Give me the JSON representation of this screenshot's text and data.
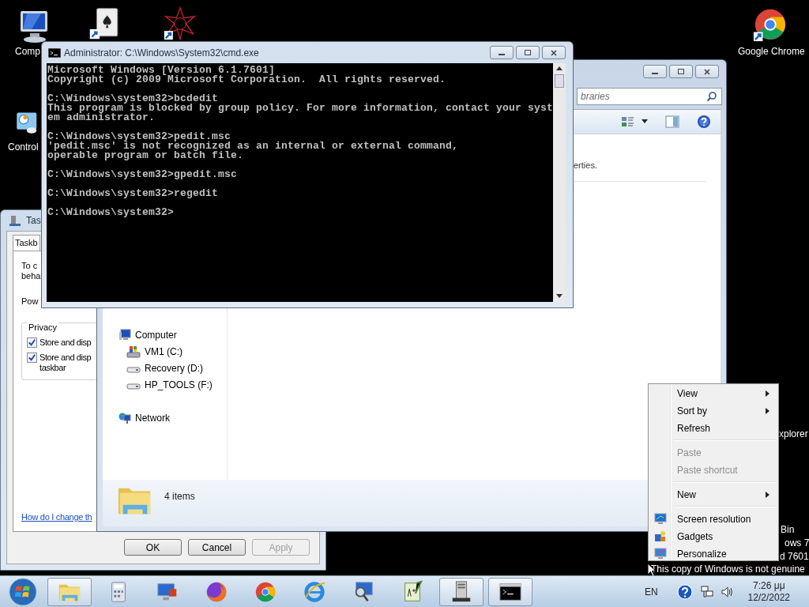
{
  "desktop": {
    "icons": [
      {
        "kind": "computer",
        "label": "Comp"
      },
      {
        "kind": "cards"
      },
      {
        "kind": "star"
      },
      {
        "kind": "control",
        "label": "Control"
      },
      {
        "kind": "chrome",
        "label": "Google Chrome"
      },
      {
        "kind": "ie",
        "label": "xplorer"
      },
      {
        "kind": "bin",
        "label": "Bin"
      }
    ],
    "watermark": [
      "ows 7",
      "d 7601",
      "This copy of Windows is not genuine"
    ]
  },
  "taskbar_dialog": {
    "title": "Tas",
    "tabs": [
      {
        "label": "Taskb",
        "selected": true
      }
    ],
    "texts": [
      "To c",
      "beha",
      "Pow"
    ],
    "group": {
      "title": "Privacy",
      "checkboxes": [
        {
          "lines": [
            "Store and disp"
          ],
          "checked": true
        },
        {
          "lines": [
            "Store and disp",
            "taskbar"
          ],
          "checked": true
        }
      ]
    },
    "link": "How do I change th",
    "buttons": [
      {
        "label": "OK",
        "disabled": false
      },
      {
        "label": "Cancel",
        "disabled": false
      },
      {
        "label": "Apply",
        "disabled": true
      }
    ]
  },
  "explorer": {
    "search": {
      "placeholder": "braries"
    },
    "content_text": "erties.",
    "nav": [
      {
        "label": "Computer",
        "children": [
          {
            "label": "VM1 (C:)"
          },
          {
            "label": "Recovery (D:)"
          },
          {
            "label": "HP_TOOLS (F:)"
          }
        ]
      },
      {
        "label": "Network"
      }
    ],
    "status": "4 items"
  },
  "cmd": {
    "title": "Administrator: C:\\Windows\\System32\\cmd.exe",
    "blocks": [
      [
        "Microsoft Windows [Version 6.1.7601]",
        "Copyright (c) 2009 Microsoft Corporation.  All rights reserved."
      ],
      [
        "C:\\Windows\\system32>bcdedit",
        "This program is blocked by group policy. For more information, contact your syst",
        "em administrator."
      ],
      [
        "C:\\Windows\\system32>pedit.msc",
        "'pedit.msc' is not recognized as an internal or external command,",
        "operable program or batch file."
      ],
      [
        "C:\\Windows\\system32>gpedit.msc"
      ],
      [
        "C:\\Windows\\system32>regedit"
      ],
      [
        "C:\\Windows\\system32>"
      ]
    ]
  },
  "context_menu": {
    "groups": [
      [
        {
          "label": "View",
          "submenu": true,
          "disabled": false
        },
        {
          "label": "Sort by",
          "submenu": true,
          "disabled": false
        },
        {
          "label": "Refresh",
          "submenu": false,
          "disabled": false
        }
      ],
      [
        {
          "label": "Paste",
          "submenu": false,
          "disabled": true
        },
        {
          "label": "Paste shortcut",
          "submenu": false,
          "disabled": true
        }
      ],
      [
        {
          "label": "New",
          "submenu": true,
          "disabled": false
        }
      ],
      [
        {
          "label": "Screen resolution",
          "submenu": false,
          "disabled": false
        },
        {
          "label": "Gadgets",
          "submenu": false,
          "disabled": false
        },
        {
          "label": "Personalize",
          "submenu": false,
          "disabled": false
        }
      ]
    ]
  },
  "taskbar": {
    "apps": [
      {
        "kind": "explorer",
        "running": true
      },
      {
        "kind": "calculator",
        "running": false
      },
      {
        "kind": "remote",
        "running": false
      },
      {
        "kind": "firefox",
        "running": false
      },
      {
        "kind": "chrome",
        "running": false
      },
      {
        "kind": "ie",
        "running": false
      },
      {
        "kind": "magnifier",
        "running": false
      },
      {
        "kind": "notepad",
        "running": false
      },
      {
        "kind": "server",
        "running": true
      },
      {
        "kind": "cmd",
        "running": true
      }
    ],
    "language": "EN",
    "time": "7:26 μμ",
    "date": "12/2/2022"
  }
}
